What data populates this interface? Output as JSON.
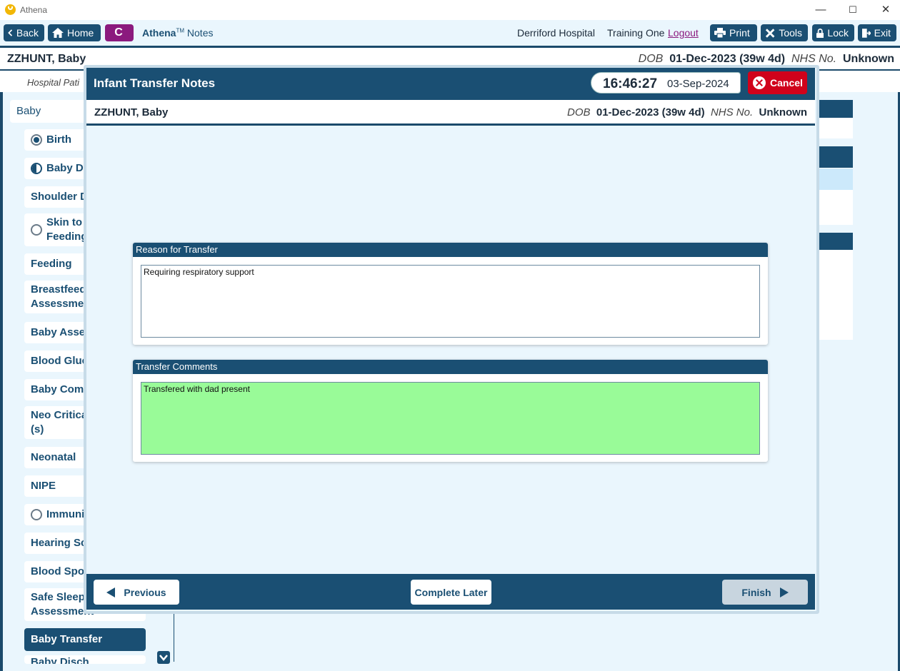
{
  "window": {
    "title": "Athena",
    "controls": [
      "—",
      "☐",
      "✕"
    ]
  },
  "toolbar": {
    "back_label": "Back",
    "home_label": "Home",
    "c_label": "C",
    "brand_name": "Athena",
    "brand_tm": "TM",
    "brand_suffix": "Notes",
    "hospital": "Derriford Hospital",
    "user": "Training One",
    "logout_label": "Logout",
    "print_label": "Print",
    "tools_label": "Tools",
    "lock_label": "Lock",
    "exit_label": "Exit"
  },
  "patient": {
    "name": "ZZHUNT, Baby",
    "dob_label": "DOB",
    "dob_value": "01-Dec-2023 (39w 4d)",
    "nhs_label": "NHS No.",
    "nhs_value": "Unknown",
    "sub_label": "Hospital Pati"
  },
  "sidebar": {
    "header": "Baby",
    "items": [
      {
        "label": "Birth",
        "radio": "filled"
      },
      {
        "label": "Baby Dev",
        "radio": "half"
      },
      {
        "label": "Shoulder D",
        "radio": "none"
      },
      {
        "label": "Skin to S\nFeeding",
        "radio": "empty"
      },
      {
        "label": "Feeding",
        "radio": "none"
      },
      {
        "label": "Breastfeedi\nAssessmen",
        "radio": "none"
      },
      {
        "label": "Baby Asses",
        "radio": "none"
      },
      {
        "label": "Blood Gluc",
        "radio": "none"
      },
      {
        "label": "Baby Comr",
        "radio": "none"
      },
      {
        "label": "Neo Critica\n(s)",
        "radio": "none"
      },
      {
        "label": "Neonatal",
        "radio": "none"
      },
      {
        "label": "NIPE",
        "radio": "none"
      },
      {
        "label": "Immunis",
        "radio": "empty"
      },
      {
        "label": "Hearing Sc",
        "radio": "none"
      },
      {
        "label": "Blood Spot",
        "radio": "none"
      },
      {
        "label": "Safe Sleepi\nAssessment",
        "radio": "none"
      },
      {
        "label": "Baby Transfer",
        "radio": "none"
      },
      {
        "label": "Baby Disch",
        "radio": "none"
      }
    ]
  },
  "modal": {
    "title": "Infant Transfer Notes",
    "time": "16:46:27",
    "date": "03-Sep-2024",
    "cancel_label": "Cancel",
    "patient_name": "ZZHUNT, Baby",
    "dob_label": "DOB",
    "dob_value": "01-Dec-2023 (39w 4d)",
    "nhs_label": "NHS No.",
    "nhs_value": "Unknown",
    "reason_panel": {
      "title": "Reason for Transfer",
      "value": "Requiring respiratory support"
    },
    "comments_panel": {
      "title": "Transfer Comments",
      "value": "Transfered with dad present"
    },
    "previous_label": "Previous",
    "complete_later_label": "Complete Later",
    "finish_label": "Finish"
  },
  "colors": {
    "primary": "#1a4f73",
    "accent": "#8b1a7e",
    "cancel": "#d0021b",
    "comments_bg": "#99fb98",
    "background": "#eaf6fd"
  }
}
